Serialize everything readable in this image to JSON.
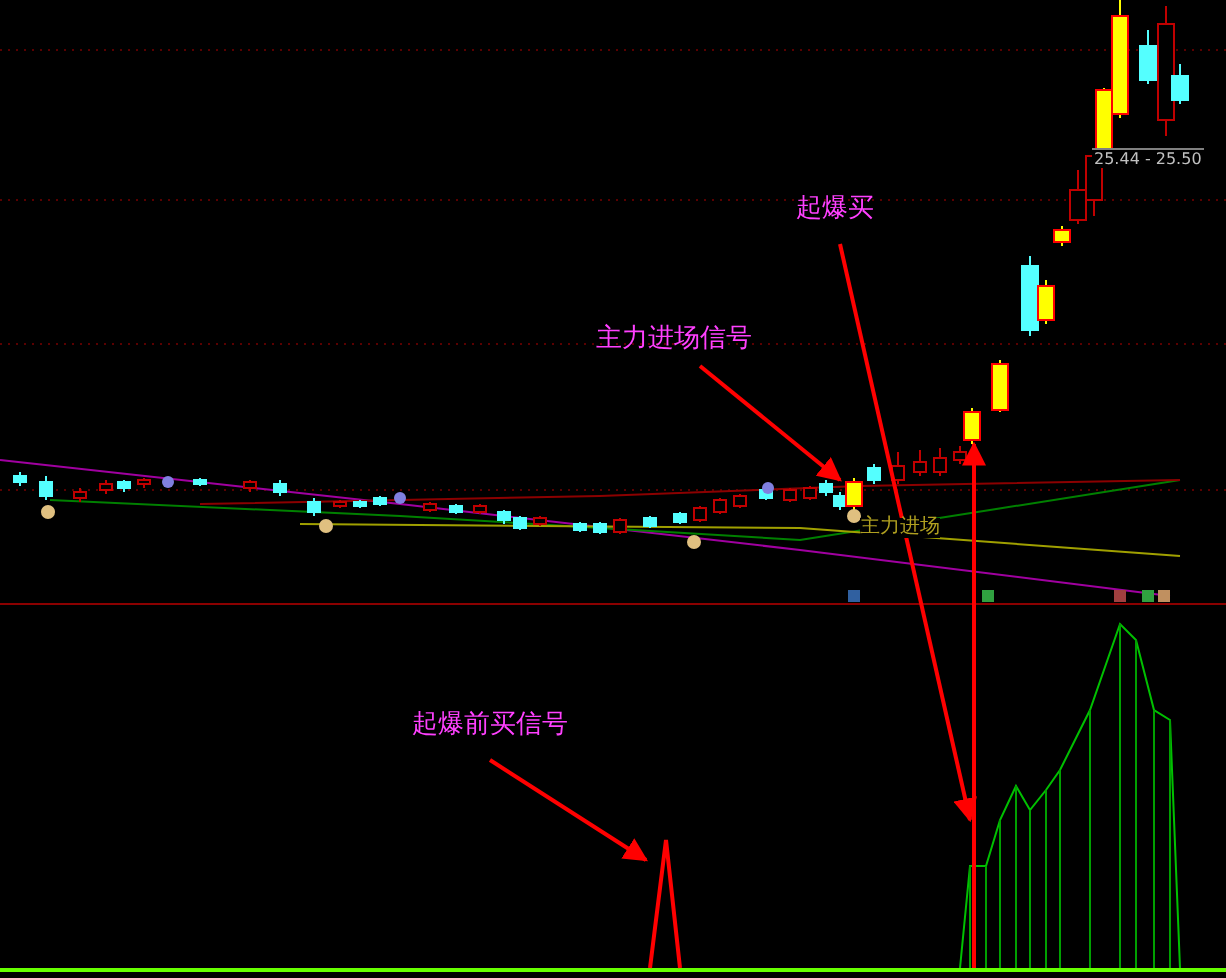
{
  "annotations": [
    {
      "kind": "label",
      "text": "起爆买"
    },
    {
      "kind": "label",
      "text": "主力进场信号"
    },
    {
      "kind": "label",
      "text": "起爆前买信号"
    }
  ],
  "price_range_label": "25.44 - 25.50",
  "signal_label": "主力进场"
}
